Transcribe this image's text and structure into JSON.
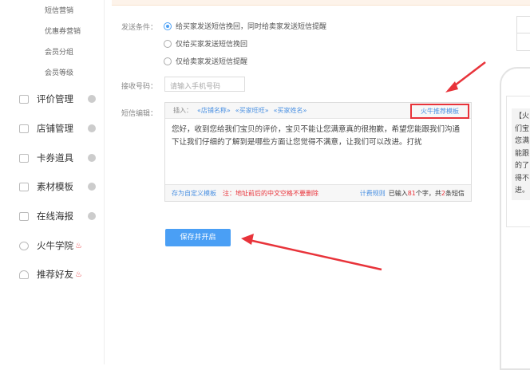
{
  "sidebar": {
    "subitems": [
      "短信营销",
      "优惠券营销",
      "会员分组",
      "会员等级"
    ],
    "items": [
      {
        "label": "评价管理"
      },
      {
        "label": "店铺管理"
      },
      {
        "label": "卡券道具"
      },
      {
        "label": "素材模板"
      },
      {
        "label": "在线海报"
      },
      {
        "label": "火牛学院"
      },
      {
        "label": "推荐好友"
      }
    ]
  },
  "form": {
    "send_condition_label": "发送条件：",
    "options": [
      "给买家发送短信挽回，同时给卖家发送短信提醒",
      "仅给买家发送短信挽回",
      "仅给卖家发送短信提醒"
    ],
    "phone_label": "接收号码：",
    "phone_placeholder": "请输入手机号码",
    "editor_label": "短信编辑：",
    "insert_label": "插入：",
    "insert_tags": [
      "«店铺名称»",
      "«买家旺旺»",
      "«买家姓名»"
    ],
    "template_button": "火牛推荐模板",
    "content": "您好，收到您给我们宝贝的评价，宝贝不能让您满意真的很抱歉，希望您能跟我们沟通下让我们仔细的了解到是哪些方面让您觉得不满意，让我们可以改进。打扰",
    "save_template": "存为自定义模板",
    "note": "注：地址前后的中文空格不要删除",
    "billing_rule": "计费规则",
    "count_prefix": "已输入",
    "count": "81",
    "count_mid": "个字，共",
    "sms_count": "2",
    "count_suffix": "条短信",
    "save_button": "保存并开启"
  },
  "preview": {
    "text": "【火\n们宝\n您满\n能跟\n的了\n得不\n进。"
  },
  "colors": {
    "accent": "#4a9ff5",
    "annotation": "#e8333a"
  }
}
